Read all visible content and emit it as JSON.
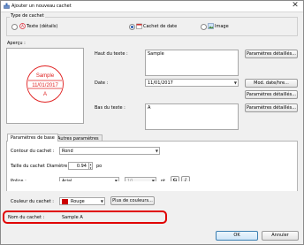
{
  "window": {
    "title": "Ajouter un nouveau cachet",
    "close_glyph": "✕"
  },
  "stamp_type": {
    "group_label": "Type de cachet",
    "options": [
      {
        "label": "Texte (détails)",
        "selected": false,
        "icon": "text-stamp-icon"
      },
      {
        "label": "Cachet de date",
        "selected": true,
        "icon": "date-stamp-icon"
      },
      {
        "label": "Image",
        "selected": false,
        "icon": "image-icon"
      }
    ]
  },
  "preview": {
    "label": "Aperçu :",
    "lines": [
      "Sample",
      "11/01/2017",
      "A"
    ],
    "stamp_color": "#e02020"
  },
  "fields": {
    "top_label": "Haut du texte :",
    "top_value": "Sample",
    "top_btn": "Paramètres détaillés...",
    "date_label": "Date :",
    "date_value": "11/01/2017",
    "date_btn_format": "Mod. date/hre...",
    "date_btn_details": "Paramètres détaillés...",
    "bottom_label": "Bas du texte :",
    "bottom_value": "A",
    "bottom_btn": "Paramètres détaillés..."
  },
  "tabs": {
    "basic": "Paramètres de base",
    "other": "Autres paramètres"
  },
  "basic": {
    "outline_label": "Contour du cachet :",
    "outline_value": "Rond",
    "size_label": "Taille du cachet",
    "diameter_label": "Diamètre :",
    "diameter_value": "0.94",
    "diameter_unit": "po",
    "font_label": "Police :",
    "font_value": "Arial",
    "font_size_value": "10",
    "font_size_unit": "pt",
    "bold_label": "G",
    "italic_label": "I",
    "color_label": "Couleur du cachet :",
    "color_value": "Rouge",
    "color_swatch": "#cc0000",
    "more_colors_btn": "Plus de couleurs..."
  },
  "name": {
    "label": "Nom du cachet :",
    "value": "Sample A"
  },
  "highlight_color": "#e00000",
  "actions": {
    "ok": "OK",
    "cancel": "Annuler"
  }
}
